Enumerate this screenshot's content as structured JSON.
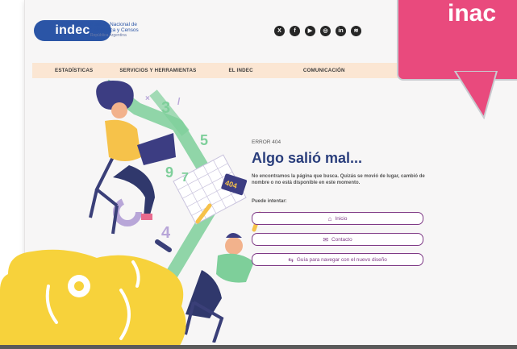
{
  "header": {
    "logo_text": "indec",
    "org_lines": [
      "Instituto Nacional de",
      "Estadística y Censos",
      "República Argentina"
    ],
    "social_icons": [
      "x-icon",
      "facebook-icon",
      "youtube-icon",
      "instagram-icon",
      "linkedin-icon",
      "spotify-icon"
    ]
  },
  "nav": {
    "items": [
      "ESTADÍSTICAS",
      "SERVICIOS Y HERRAMIENTAS",
      "EL INDEC",
      "COMUNICACIÓN"
    ]
  },
  "error": {
    "code": "ERROR 404",
    "title": "Algo salió mal...",
    "description": "No encontramos la página que busca. Quizás se movió de lugar, cambió de nombre o no está disponible en este momento.",
    "hint": "Puede intentar:",
    "buttons": [
      {
        "label": "Inicio",
        "icon": "home-icon"
      },
      {
        "label": "Contacto",
        "icon": "mail-icon"
      },
      {
        "label": "Guía para navegar con el nuevo diseño",
        "icon": "signpost-icon"
      }
    ]
  },
  "overlay": {
    "callout_word": "inac"
  },
  "colors": {
    "brand": "#2b55a6",
    "title": "#2a3e7c",
    "button_border": "#7f3a86",
    "nav_bg": "#fbe6d3",
    "callout": "#e94a7d",
    "blob": "#f7d23b",
    "illustration_green": "#7ecf9a"
  }
}
